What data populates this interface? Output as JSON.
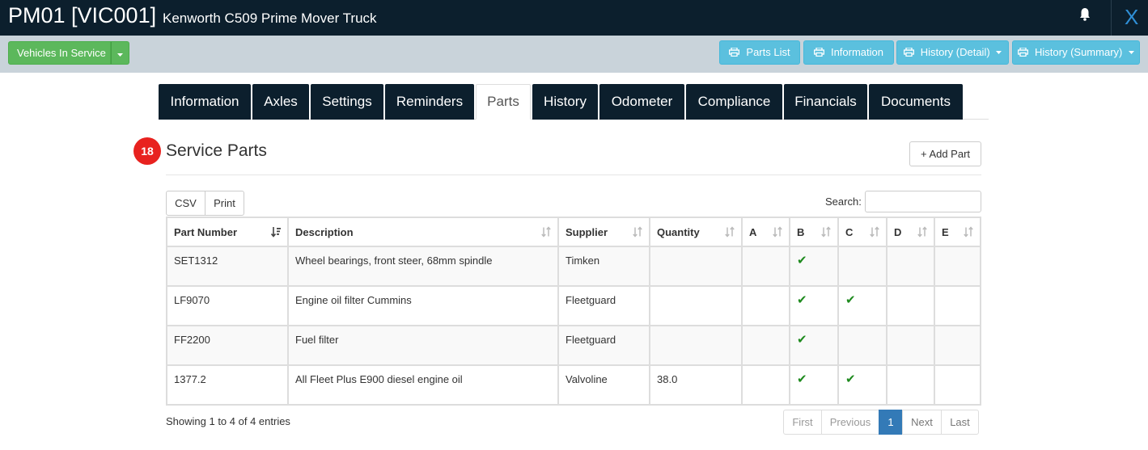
{
  "header": {
    "code": "PM01 [VIC001]",
    "model": "Kenworth C509 Prime Mover Truck",
    "close_label": "X",
    "bell_icon": "bell-icon"
  },
  "toolbar": {
    "status_button": "Vehicles In Service",
    "parts_list": "Parts List",
    "information": "Information",
    "history_detail": "History (Detail)",
    "history_summary": "History (Summary)",
    "print_icon": "print-icon"
  },
  "tabs": [
    {
      "label": "Information"
    },
    {
      "label": "Axles"
    },
    {
      "label": "Settings"
    },
    {
      "label": "Reminders"
    },
    {
      "label": "Parts"
    },
    {
      "label": "History"
    },
    {
      "label": "Odometer"
    },
    {
      "label": "Compliance"
    },
    {
      "label": "Financials"
    },
    {
      "label": "Documents"
    }
  ],
  "active_tab": "Parts",
  "section": {
    "badge": "18",
    "title": "Service Parts",
    "add_button": "+  Add Part"
  },
  "export": {
    "csv": "CSV",
    "print": "Print"
  },
  "search": {
    "label": "Search:",
    "value": ""
  },
  "table": {
    "columns": [
      "Part Number",
      "Description",
      "Supplier",
      "Quantity",
      "A",
      "B",
      "C",
      "D",
      "E"
    ],
    "rows": [
      {
        "part": "SET1312",
        "desc": "Wheel bearings, front steer, 68mm spindle",
        "supplier": "Timken",
        "qty": "",
        "A": false,
        "B": true,
        "C": false,
        "D": false,
        "E": false
      },
      {
        "part": "LF9070",
        "desc": "Engine oil filter Cummins",
        "supplier": "Fleetguard",
        "qty": "",
        "A": false,
        "B": true,
        "C": true,
        "D": false,
        "E": false
      },
      {
        "part": "FF2200",
        "desc": "Fuel filter",
        "supplier": "Fleetguard",
        "qty": "",
        "A": false,
        "B": true,
        "C": false,
        "D": false,
        "E": false
      },
      {
        "part": "1377.2",
        "desc": "All Fleet Plus E900 diesel engine oil",
        "supplier": "Valvoline",
        "qty": "38.0",
        "A": false,
        "B": true,
        "C": true,
        "D": false,
        "E": false
      }
    ],
    "check_glyph": "✔"
  },
  "footer": {
    "info": "Showing 1 to 4 of 4 entries",
    "pager": {
      "first": "First",
      "previous": "Previous",
      "current": "1",
      "next": "Next",
      "last": "Last"
    }
  },
  "colors": {
    "topbar": "#0c1f2d",
    "toolbar": "#c9d3da",
    "green_button": "#5cb85c",
    "blue_button": "#5bc0de",
    "badge": "#e8221f",
    "check": "#1e8a1e",
    "pager_active": "#337ab7",
    "close": "#2f8fd6"
  }
}
